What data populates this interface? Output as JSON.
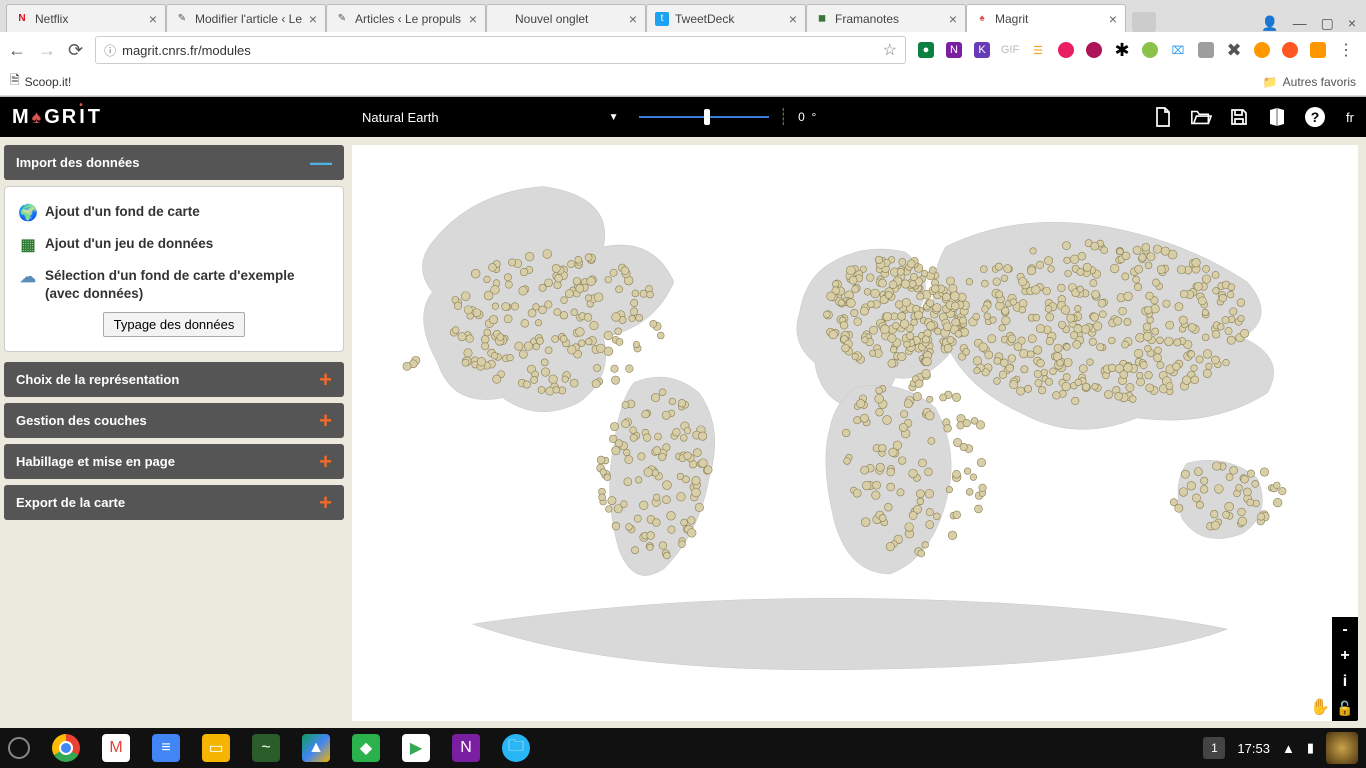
{
  "browser": {
    "tabs": [
      {
        "label": "Netflix",
        "fav_bg": "#fff",
        "fav_fg": "#e50914",
        "fav_txt": "N"
      },
      {
        "label": "Modifier l'article ‹ Le",
        "fav_bg": "#fff",
        "fav_fg": "#555",
        "fav_txt": "✎"
      },
      {
        "label": "Articles ‹ Le propuls",
        "fav_bg": "#fff",
        "fav_fg": "#555",
        "fav_txt": "✎"
      },
      {
        "label": "Nouvel onglet",
        "fav_bg": "transparent",
        "fav_fg": "#999",
        "fav_txt": ""
      },
      {
        "label": "TweetDeck",
        "fav_bg": "#1da1f2",
        "fav_fg": "#fff",
        "fav_txt": "t"
      },
      {
        "label": "Framanotes",
        "fav_bg": "#fff",
        "fav_fg": "#3c763d",
        "fav_txt": "◼"
      },
      {
        "label": "Magrit",
        "fav_bg": "#fff",
        "fav_fg": "#d9534f",
        "fav_txt": "♠"
      }
    ],
    "active_tab_index": 6,
    "url": "magrit.cnrs.fr/modules",
    "bookmarks": {
      "scoop": "Scoop.it!",
      "other": "Autres favoris"
    }
  },
  "app": {
    "projection": "Natural Earth",
    "rotation_value": "0",
    "rotation_unit": "°",
    "lang": "fr"
  },
  "sidebar": {
    "sections": {
      "import": "Import des données",
      "repr": "Choix de la représentation",
      "layers": "Gestion des couches",
      "layout": "Habillage et mise en page",
      "export": "Export de la carte"
    },
    "import_panel": {
      "add_basemap": "Ajout d'un fond de carte",
      "add_dataset": "Ajout d'un jeu de données",
      "sample": "Sélection d'un fond de carte d'exemple (avec données)",
      "typing_btn": "Typage des données"
    }
  },
  "map_controls": {
    "zoom_out": "-",
    "zoom_in": "+",
    "info": "i"
  },
  "taskbar": {
    "notif_count": "1",
    "clock": "17:53"
  },
  "colors": {
    "accent_orange": "#f06a2a",
    "accent_blue": "#4fb3e8"
  }
}
